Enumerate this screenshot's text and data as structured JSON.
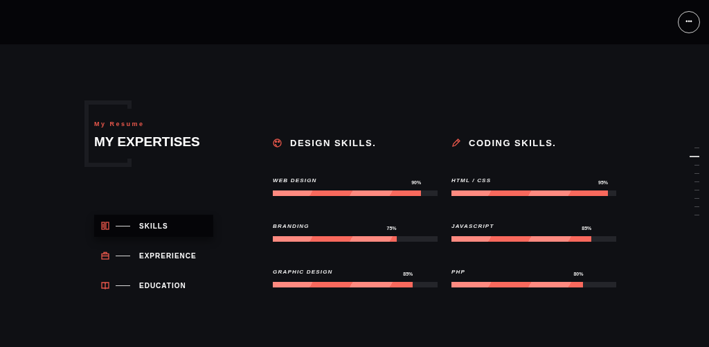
{
  "header": {
    "menu_button": "•••"
  },
  "intro": {
    "subtitle": "My Resume",
    "title": "MY EXPERTISES"
  },
  "nav": [
    {
      "label": "SKILLS",
      "kind": "skills",
      "selected": true
    },
    {
      "label": "EXPRERIENCE",
      "kind": "experience",
      "selected": false
    },
    {
      "label": "EDUCATION",
      "kind": "education",
      "selected": false
    }
  ],
  "skill_groups": [
    {
      "kind": "design",
      "title": "DESIGN SKILLS.",
      "skills": [
        {
          "name": "WEB DESIGN",
          "reading": "90%",
          "level": 0.9
        },
        {
          "name": "BRANDING",
          "reading": "75%",
          "level": 0.75
        },
        {
          "name": "GRAPHIC DESIGN",
          "reading": "85%",
          "level": 0.85
        }
      ]
    },
    {
      "kind": "coding",
      "title": "CODING SKILLS.",
      "skills": [
        {
          "name": "HTML / CSS",
          "reading": "95%",
          "level": 0.95
        },
        {
          "name": "JAVASCRIPT",
          "reading": "85%",
          "level": 0.85
        },
        {
          "name": "PHP",
          "reading": "80%",
          "level": 0.8
        }
      ]
    }
  ],
  "page_indicators": [
    {
      "selected": false
    },
    {
      "selected": true
    },
    {
      "selected": false
    },
    {
      "selected": false
    },
    {
      "selected": false
    },
    {
      "selected": false
    },
    {
      "selected": false
    },
    {
      "selected": false
    },
    {
      "selected": false
    }
  ]
}
